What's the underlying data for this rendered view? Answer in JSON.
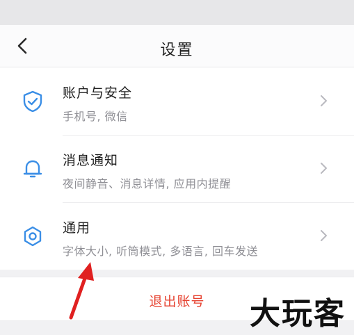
{
  "header": {
    "title": "设置",
    "back_icon": "chevron-left-icon"
  },
  "items": [
    {
      "title": "账户与安全",
      "subtitle": "手机号, 微信",
      "icon": "shield-check-icon",
      "chevron": "chevron-right-icon"
    },
    {
      "title": "消息通知",
      "subtitle": "夜间静音、消息详情, 应用内提醒",
      "icon": "bell-icon",
      "chevron": "chevron-right-icon"
    },
    {
      "title": "通用",
      "subtitle": "字体大小, 听筒模式, 多语言, 回车发送",
      "icon": "gear-icon",
      "chevron": "chevron-right-icon"
    }
  ],
  "logout": {
    "label": "退出账号"
  },
  "watermark": {
    "text": "大玩客"
  },
  "colors": {
    "accent": "#3a8ee6",
    "danger": "#e6412f",
    "annotation_arrow": "#e02020"
  }
}
